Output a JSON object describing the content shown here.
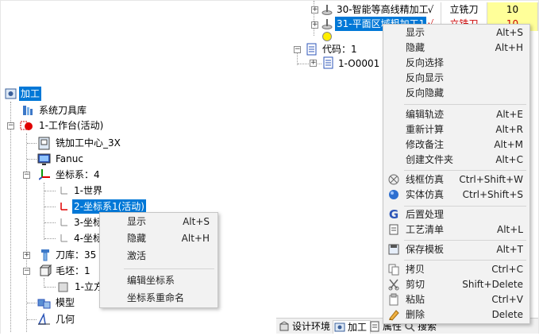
{
  "right_tree": {
    "rows": [
      {
        "label": "30-智能等高线精加工",
        "check": "√",
        "tool_type": "立铣刀",
        "num": "10"
      },
      {
        "label": "31-平面区域粗加工1",
        "check": "√",
        "tool_type": "立铣刀",
        "num": "10"
      }
    ],
    "code_label": "代码：1",
    "code_item": "1-O0001"
  },
  "left_tree": {
    "root": "加工",
    "tool_lib": "系统刀具库",
    "workbench": "1-工作台(活动)",
    "machine": "铣加工中心_3X",
    "controller": "Fanuc",
    "coord_sys": "坐标系：4",
    "coord_items": [
      "1-世界",
      "2-坐标系1(活动)",
      "3-坐标",
      "4-坐标"
    ],
    "tool_store": "刀库：35",
    "blank": "毛坯：1",
    "blank_item": "1-立方",
    "model": "模型",
    "geometry": "几何"
  },
  "right_menu": {
    "groups": [
      [
        {
          "label": "显示",
          "shortcut": "Alt+S",
          "icon": ""
        },
        {
          "label": "隐藏",
          "shortcut": "Alt+H",
          "icon": ""
        },
        {
          "label": "反向选择",
          "shortcut": "",
          "icon": ""
        },
        {
          "label": "反向显示",
          "shortcut": "",
          "icon": ""
        },
        {
          "label": "反向隐藏",
          "shortcut": "",
          "icon": ""
        }
      ],
      [
        {
          "label": "编辑轨迹",
          "shortcut": "Alt+E",
          "icon": ""
        },
        {
          "label": "重新计算",
          "shortcut": "Alt+R",
          "icon": ""
        },
        {
          "label": "修改备注",
          "shortcut": "Alt+M",
          "icon": ""
        },
        {
          "label": "创建文件夹",
          "shortcut": "Alt+C",
          "icon": ""
        }
      ],
      [
        {
          "label": "线框仿真",
          "shortcut": "Ctrl+Shift+W",
          "icon": "wireframe-sim-icon"
        },
        {
          "label": "实体仿真",
          "shortcut": "Ctrl+Shift+S",
          "icon": "solid-sim-icon"
        }
      ],
      [
        {
          "label": "后置处理",
          "shortcut": "",
          "icon": "post-process-icon"
        },
        {
          "label": "工艺清单",
          "shortcut": "Alt+L",
          "icon": "process-list-icon"
        }
      ],
      [
        {
          "label": "保存模板",
          "shortcut": "Alt+T",
          "icon": "save-template-icon"
        }
      ],
      [
        {
          "label": "拷贝",
          "shortcut": "Ctrl+C",
          "icon": "copy-icon"
        },
        {
          "label": "剪切",
          "shortcut": "Shift+Delete",
          "icon": "cut-icon"
        },
        {
          "label": "粘贴",
          "shortcut": "Ctrl+V",
          "icon": "paste-icon"
        },
        {
          "label": "删除",
          "shortcut": "Delete",
          "icon": "delete-icon"
        }
      ]
    ]
  },
  "left_menu": {
    "groups": [
      [
        {
          "label": "显示",
          "shortcut": "Alt+S"
        },
        {
          "label": "隐藏",
          "shortcut": "Alt+H"
        },
        {
          "label": "激活",
          "shortcut": ""
        }
      ],
      [
        {
          "label": "编辑坐标系",
          "shortcut": ""
        },
        {
          "label": "坐标系重命名",
          "shortcut": ""
        }
      ]
    ]
  },
  "bottom_tabs": [
    {
      "label": "设计环境",
      "icon": "design-env-icon"
    },
    {
      "label": "加工",
      "icon": "machining-icon"
    },
    {
      "label": "属性",
      "icon": "properties-icon"
    },
    {
      "label": "搜索",
      "icon": "search-icon"
    }
  ],
  "colors": {
    "selection": "#0078d7",
    "highlight_row": "#ffff99",
    "menu_bg": "#f2f2f2",
    "red": "#e00000"
  }
}
